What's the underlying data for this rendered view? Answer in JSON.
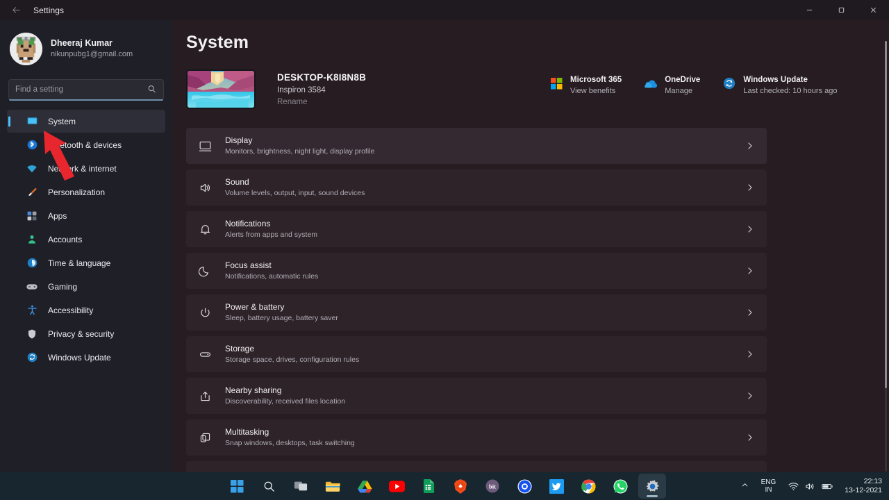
{
  "window": {
    "title": "Settings",
    "back_icon": "back-arrow-icon",
    "controls": {
      "minimize": "minimize-icon",
      "maximize": "maximize-icon",
      "close": "close-icon"
    }
  },
  "account": {
    "name": "Dheeraj Kumar",
    "email": "nikunpubg1@gmail.com",
    "avatar": "user-avatar"
  },
  "search": {
    "placeholder": "Find a setting",
    "value": "",
    "icon": "search-icon"
  },
  "sidebar": {
    "items": [
      {
        "label": "System",
        "icon": "system-icon",
        "selected": true
      },
      {
        "label": "Bluetooth & devices",
        "icon": "bluetooth-icon",
        "selected": false
      },
      {
        "label": "Network & internet",
        "icon": "wifi-icon",
        "selected": false
      },
      {
        "label": "Personalization",
        "icon": "paintbrush-icon",
        "selected": false
      },
      {
        "label": "Apps",
        "icon": "apps-grid-icon",
        "selected": false
      },
      {
        "label": "Accounts",
        "icon": "person-icon",
        "selected": false
      },
      {
        "label": "Time & language",
        "icon": "clock-icon",
        "selected": false
      },
      {
        "label": "Gaming",
        "icon": "gamepad-icon",
        "selected": false
      },
      {
        "label": "Accessibility",
        "icon": "accessibility-icon",
        "selected": false
      },
      {
        "label": "Privacy & security",
        "icon": "shield-icon",
        "selected": false
      },
      {
        "label": "Windows Update",
        "icon": "update-refresh-icon",
        "selected": false
      }
    ]
  },
  "main": {
    "page_title": "System",
    "device": {
      "name": "DESKTOP-K8I8N8B",
      "model": "Inspiron 3584",
      "rename_label": "Rename",
      "thumbnail": "desktop-wallpaper-thumbnail"
    },
    "quick_links": [
      {
        "title": "Microsoft 365",
        "subtitle": "View benefits",
        "icon": "microsoft-logo-icon"
      },
      {
        "title": "OneDrive",
        "subtitle": "Manage",
        "icon": "onedrive-cloud-icon"
      },
      {
        "title": "Windows Update",
        "subtitle": "Last checked: 10 hours ago",
        "icon": "update-refresh-icon"
      }
    ],
    "rows": [
      {
        "title": "Display",
        "subtitle": "Monitors, brightness, night light, display profile",
        "icon": "monitor-icon"
      },
      {
        "title": "Sound",
        "subtitle": "Volume levels, output, input, sound devices",
        "icon": "speaker-icon"
      },
      {
        "title": "Notifications",
        "subtitle": "Alerts from apps and system",
        "icon": "bell-icon"
      },
      {
        "title": "Focus assist",
        "subtitle": "Notifications, automatic rules",
        "icon": "moon-icon"
      },
      {
        "title": "Power & battery",
        "subtitle": "Sleep, battery usage, battery saver",
        "icon": "power-icon"
      },
      {
        "title": "Storage",
        "subtitle": "Storage space, drives, configuration rules",
        "icon": "storage-drive-icon"
      },
      {
        "title": "Nearby sharing",
        "subtitle": "Discoverability, received files location",
        "icon": "share-icon"
      },
      {
        "title": "Multitasking",
        "subtitle": "Snap windows, desktops, task switching",
        "icon": "multitasking-windows-icon"
      }
    ],
    "chevron_icon": "chevron-right-icon"
  },
  "annotation": {
    "arrow": "red-pointer-arrow",
    "color": "#e8262d"
  },
  "taskbar": {
    "apps": [
      {
        "name": "start-button",
        "icon": "windows-start-icon",
        "active": false
      },
      {
        "name": "search-button",
        "icon": "search-icon",
        "active": false
      },
      {
        "name": "task-view-button",
        "icon": "task-view-icon",
        "active": false
      },
      {
        "name": "file-explorer",
        "icon": "folder-icon",
        "active": false
      },
      {
        "name": "google-drive",
        "icon": "google-drive-icon",
        "active": false
      },
      {
        "name": "youtube",
        "icon": "youtube-icon",
        "active": false
      },
      {
        "name": "google-sheets",
        "icon": "sheets-icon",
        "active": false
      },
      {
        "name": "brave-browser",
        "icon": "brave-lion-icon",
        "active": false
      },
      {
        "name": "bitly",
        "icon": "bitly-icon",
        "active": false
      },
      {
        "name": "coinbase",
        "icon": "blue-circle-app-icon",
        "active": false
      },
      {
        "name": "twitter",
        "icon": "twitter-bird-icon",
        "active": false
      },
      {
        "name": "google-chrome",
        "icon": "chrome-icon",
        "active": false
      },
      {
        "name": "whatsapp",
        "icon": "whatsapp-icon",
        "active": false
      },
      {
        "name": "settings-app",
        "icon": "gear-icon",
        "active": true
      }
    ],
    "tray": {
      "chevron": "chevron-up-icon",
      "language_top": "ENG",
      "language_bottom": "IN",
      "wifi_icon": "wifi-icon",
      "volume_icon": "speaker-icon",
      "battery_icon": "battery-icon",
      "time": "22:13",
      "date": "13-12-2021"
    }
  },
  "colors": {
    "accent": "#4cc2ff",
    "sidebar_bg": "#1f1f27",
    "main_bg": "#261c21",
    "row_bg": "#2e2329",
    "taskbar_bg": "#17262f",
    "annotation_red": "#e8262d"
  }
}
